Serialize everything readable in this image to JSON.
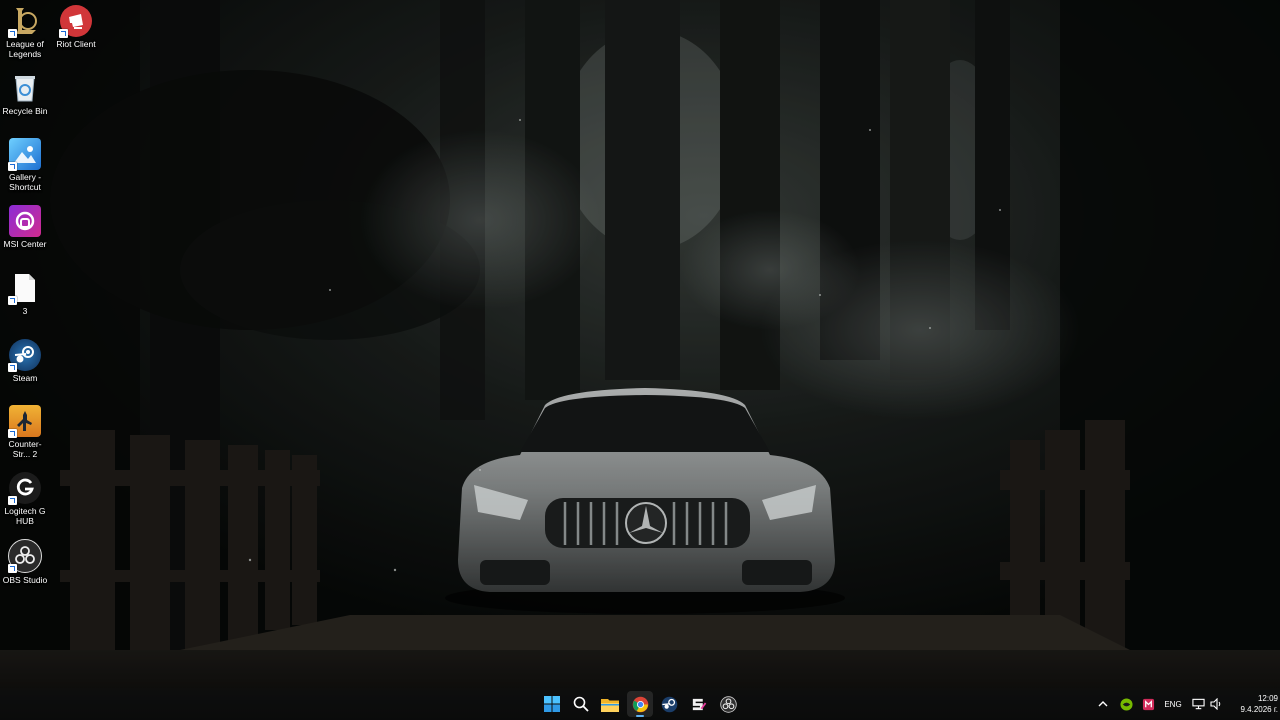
{
  "desktop": {
    "icons": [
      {
        "label": "League of Legends",
        "icon": "league-of-legends-icon"
      },
      {
        "label": "Riot Client",
        "icon": "riot-client-icon"
      },
      {
        "label": "Recycle Bin",
        "icon": "recycle-bin-icon"
      },
      {
        "label": "Gallery - Shortcut",
        "icon": "gallery-icon"
      },
      {
        "label": "MSI Center",
        "icon": "msi-center-icon"
      },
      {
        "label": "3",
        "icon": "file-icon"
      },
      {
        "label": "Steam",
        "icon": "steam-icon"
      },
      {
        "label": "Counter-Str... 2",
        "icon": "counter-strike-icon"
      },
      {
        "label": "Logitech G HUB",
        "icon": "logitech-ghub-icon"
      },
      {
        "label": "OBS Studio",
        "icon": "obs-studio-icon"
      }
    ]
  },
  "taskbar": {
    "apps": [
      {
        "name": "Start",
        "icon": "windows-start-icon"
      },
      {
        "name": "Search",
        "icon": "search-icon"
      },
      {
        "name": "File Explorer",
        "icon": "file-explorer-icon"
      },
      {
        "name": "Google Chrome",
        "icon": "chrome-icon",
        "active": true
      },
      {
        "name": "Steam",
        "icon": "steam-icon"
      },
      {
        "name": "App",
        "icon": "app-s-icon"
      },
      {
        "name": "OBS Studio",
        "icon": "obs-studio-icon"
      }
    ],
    "tray": {
      "language": "ENG",
      "time": "12:09",
      "date": "9.4.2026 г."
    }
  },
  "colors": {
    "taskbar_bg": "#0e1010",
    "accent": "#5fb2f2"
  }
}
